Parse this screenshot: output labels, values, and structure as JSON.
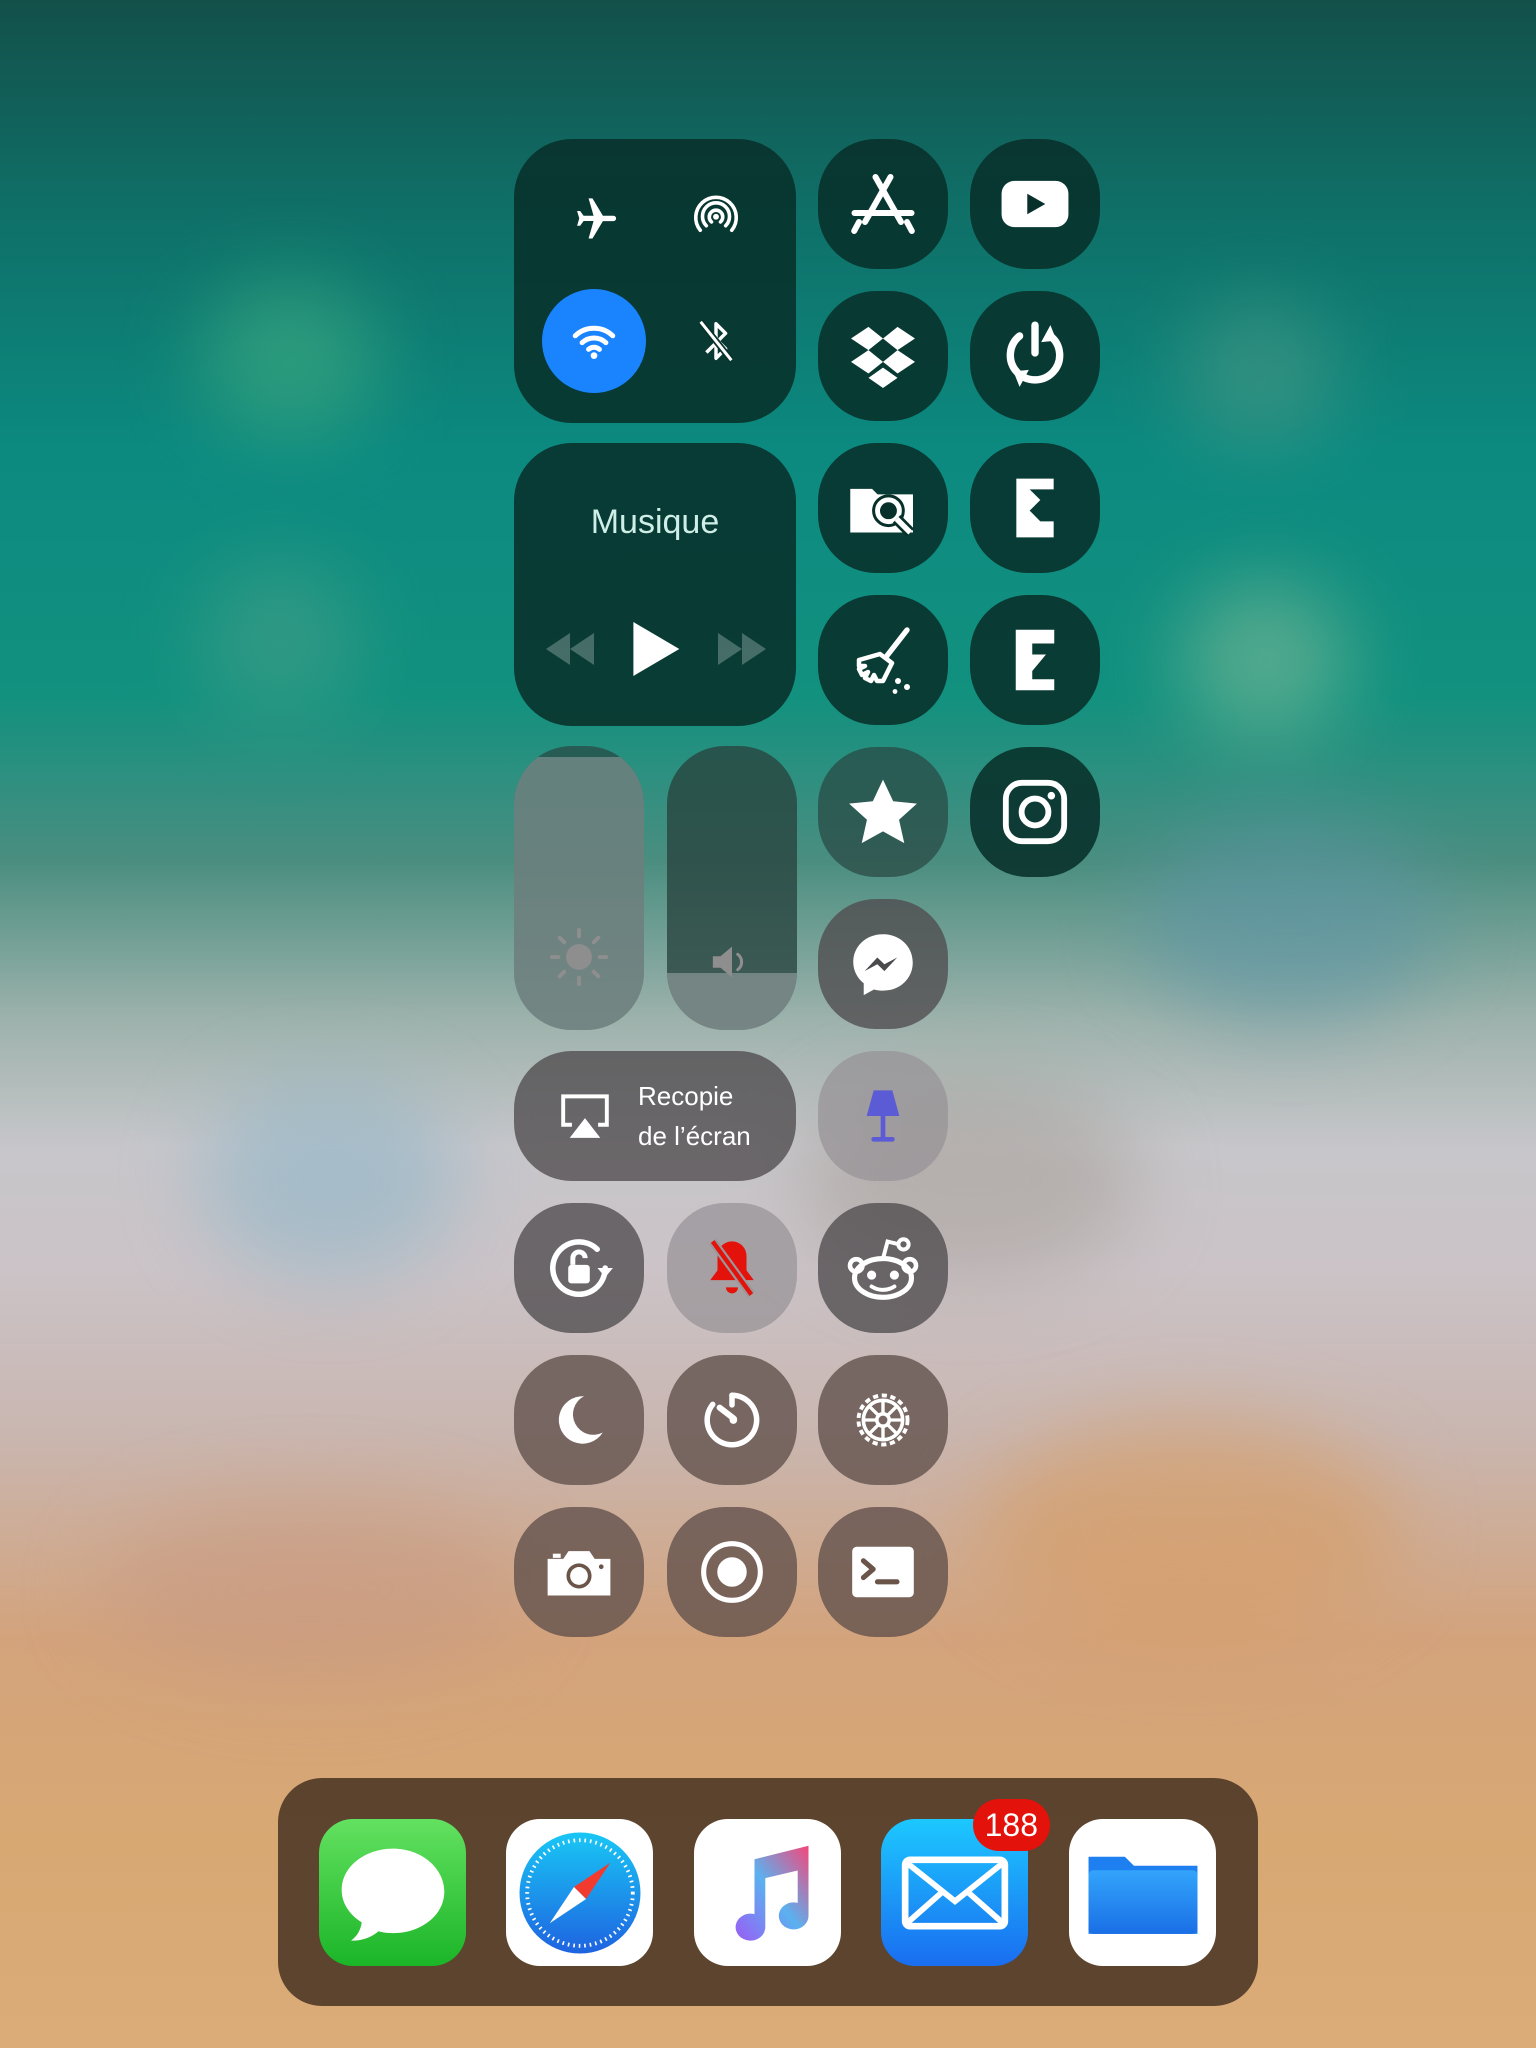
{
  "music": {
    "title": "Musique"
  },
  "screen_mirroring": {
    "line1": "Recopie",
    "line2": "de l’écran"
  },
  "toggles": {
    "airplane": "airplane-icon",
    "airdrop": "airdrop-icon",
    "wifi": "wifi-icon",
    "bluetooth": "bluetooth-off-icon"
  },
  "state": {
    "wifi_on": true,
    "bluetooth_on": false,
    "silent_mode_on": true,
    "brightness_level": 0.96,
    "volume_level": 0.2
  },
  "colors": {
    "wifi_active": "#1a84ff",
    "silent_bell": "#e3120b",
    "lamp": "#5b5bd6",
    "mail_badge": "#e3120b"
  },
  "shortcut_tiles": [
    "app-store-icon",
    "youtube-icon",
    "dropbox-icon",
    "power-restart-icon",
    "folder-search-icon",
    "electra-icon",
    "broom-clean-icon",
    "e-jailbreak-icon",
    "star-icon",
    "instagram-icon",
    "messenger-icon",
    "lamp-icon",
    "orientation-lock-icon",
    "silent-bell-icon",
    "reddit-icon",
    "moon-icon",
    "timer-icon",
    "settings-gear-icon",
    "camera-icon",
    "screen-record-icon",
    "terminal-icon"
  ],
  "dock": {
    "apps": [
      "messages-icon",
      "safari-icon",
      "music-icon",
      "mail-icon",
      "files-icon"
    ],
    "mail_badge": "188"
  }
}
